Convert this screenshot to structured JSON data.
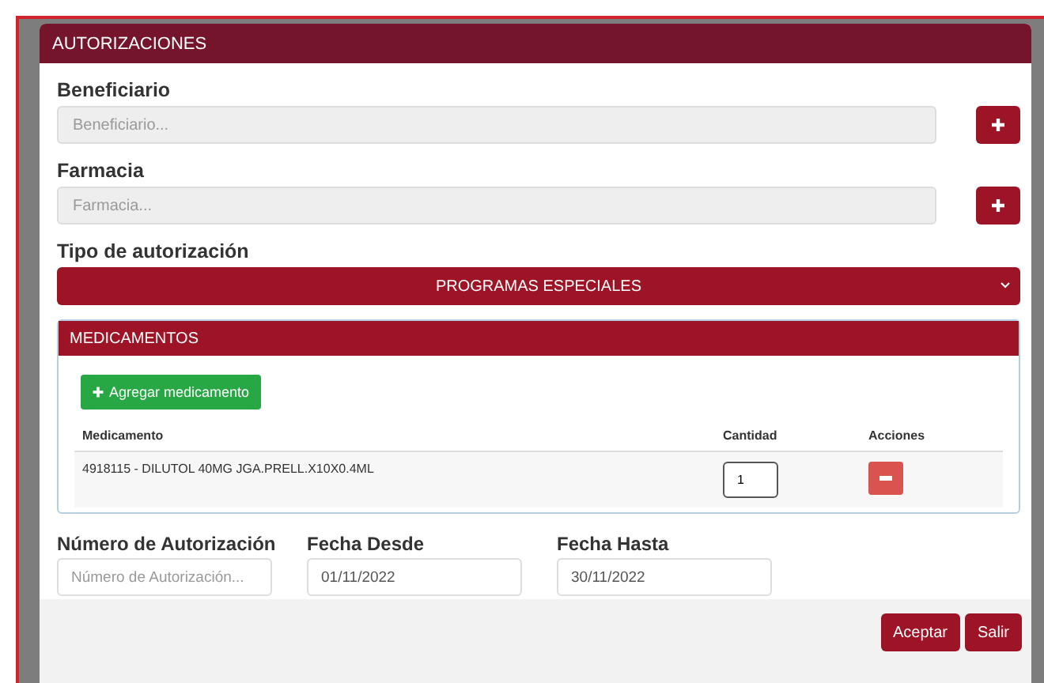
{
  "modal": {
    "title": "AUTORIZACIONES"
  },
  "beneficiario": {
    "label": "Beneficiario",
    "placeholder": "Beneficiario..."
  },
  "farmacia": {
    "label": "Farmacia",
    "placeholder": "Farmacia..."
  },
  "tipo": {
    "label": "Tipo de autorización",
    "value": "PROGRAMAS ESPECIALES"
  },
  "medicamentos": {
    "title": "MEDICAMENTOS",
    "add_button": "Agregar medicamento",
    "columns": [
      "Medicamento",
      "Cantidad",
      "Acciones"
    ],
    "rows": [
      {
        "medicamento": "4918115 - DILUTOL 40MG JGA.PRELL.X10X0.4ML",
        "cantidad": "1"
      }
    ]
  },
  "fields": [
    {
      "label": "Número de Autorización",
      "placeholder": "Número de Autorización..."
    },
    {
      "label": "Fecha Desde",
      "value": "01/11/2022"
    },
    {
      "label": "Fecha Hasta",
      "value": "30/11/2022"
    }
  ],
  "buttons": [
    "Aceptar",
    "Salir"
  ]
}
